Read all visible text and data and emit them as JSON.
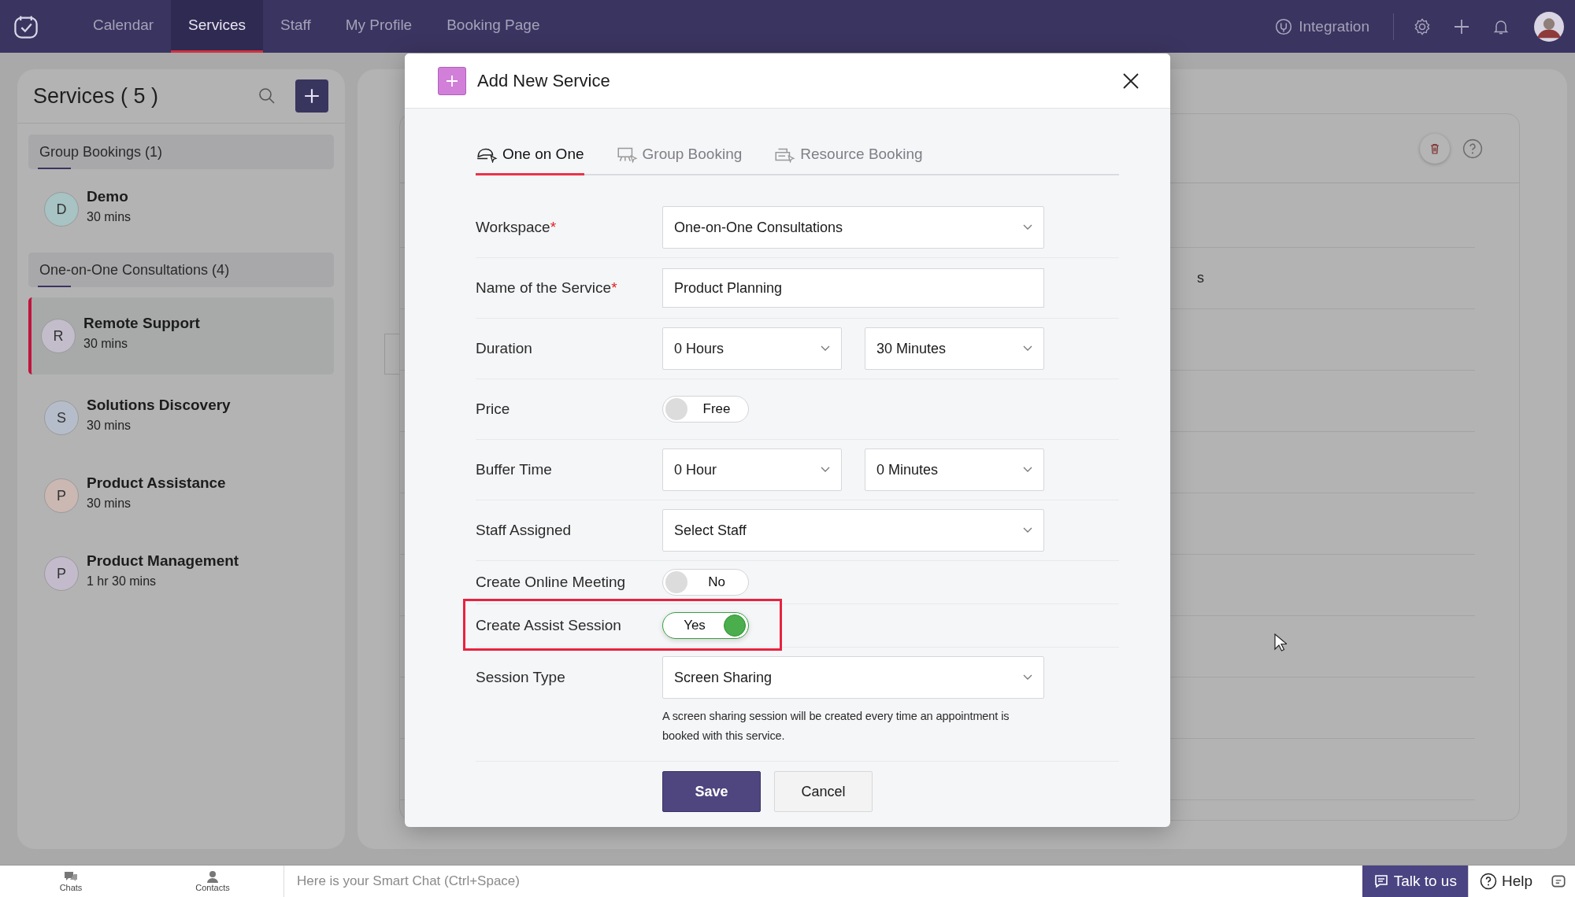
{
  "topbar": {
    "nav": [
      {
        "label": "Calendar",
        "selected": false
      },
      {
        "label": "Services",
        "selected": true
      },
      {
        "label": "Staff",
        "selected": false
      },
      {
        "label": "My Profile",
        "selected": false
      },
      {
        "label": "Booking Page",
        "selected": false
      }
    ],
    "integration": "Integration"
  },
  "sidebar": {
    "title": "Services ( 5 )",
    "groups": [
      {
        "label": "Group Bookings (1)",
        "items": [
          {
            "initial": "D",
            "name": "Demo",
            "duration": "30 mins",
            "color": "#a7c3c3",
            "selected": false
          }
        ]
      },
      {
        "label": "One-on-One Consultations (4)",
        "items": [
          {
            "initial": "R",
            "name": "Remote Support",
            "duration": "30 mins",
            "color": "#c3bccb",
            "selected": true
          },
          {
            "initial": "S",
            "name": "Solutions Discovery",
            "duration": "30 mins",
            "color": "#b6bdca",
            "selected": false
          },
          {
            "initial": "P",
            "name": "Product Assistance",
            "duration": "30 mins",
            "color": "#cbb8b3",
            "selected": false
          },
          {
            "initial": "P",
            "name": "Product Management",
            "duration": "1 hr 30 mins",
            "color": "#c3bacb",
            "selected": false
          }
        ]
      }
    ]
  },
  "main": {
    "partial_text": "s"
  },
  "modal": {
    "title": "Add New Service",
    "tabs": [
      {
        "label": "One on One",
        "selected": true
      },
      {
        "label": "Group Booking",
        "selected": false
      },
      {
        "label": "Resource Booking",
        "selected": false
      }
    ],
    "fields": [
      {
        "kind": "select",
        "label": "Workspace",
        "required_mark": "*",
        "values": [
          "One-on-One Consultations"
        ]
      },
      {
        "kind": "text",
        "label": "Name of the Service",
        "required_mark": "*",
        "value": "Product Planning"
      },
      {
        "kind": "select",
        "label": "Duration",
        "values": [
          "0 Hours",
          "30 Minutes"
        ]
      },
      {
        "kind": "toggle",
        "label": "Price",
        "on": false,
        "value": "Free"
      },
      {
        "kind": "select",
        "label": "Buffer Time",
        "values": [
          "0 Hour",
          "0 Minutes"
        ]
      },
      {
        "kind": "select",
        "label": "Staff Assigned",
        "values": [
          "Select Staff"
        ]
      },
      {
        "kind": "toggle",
        "label": "Create Online Meeting",
        "on": false,
        "value": "No"
      },
      {
        "kind": "toggle",
        "label": "Create Assist Session",
        "on": true,
        "value": "Yes",
        "highlighted": true
      },
      {
        "kind": "select",
        "label": "Session Type",
        "values": [
          "Screen Sharing"
        ],
        "hint": "A screen sharing session will be created every time an appointment is booked with this service."
      }
    ],
    "buttons": [
      "Save",
      "Cancel"
    ]
  },
  "bottom": {
    "chats": "Chats",
    "contacts": "Contacts",
    "chat_placeholder": "Here is your Smart Chat (Ctrl+Space)",
    "talk": "Talk to us",
    "help": "Help"
  }
}
